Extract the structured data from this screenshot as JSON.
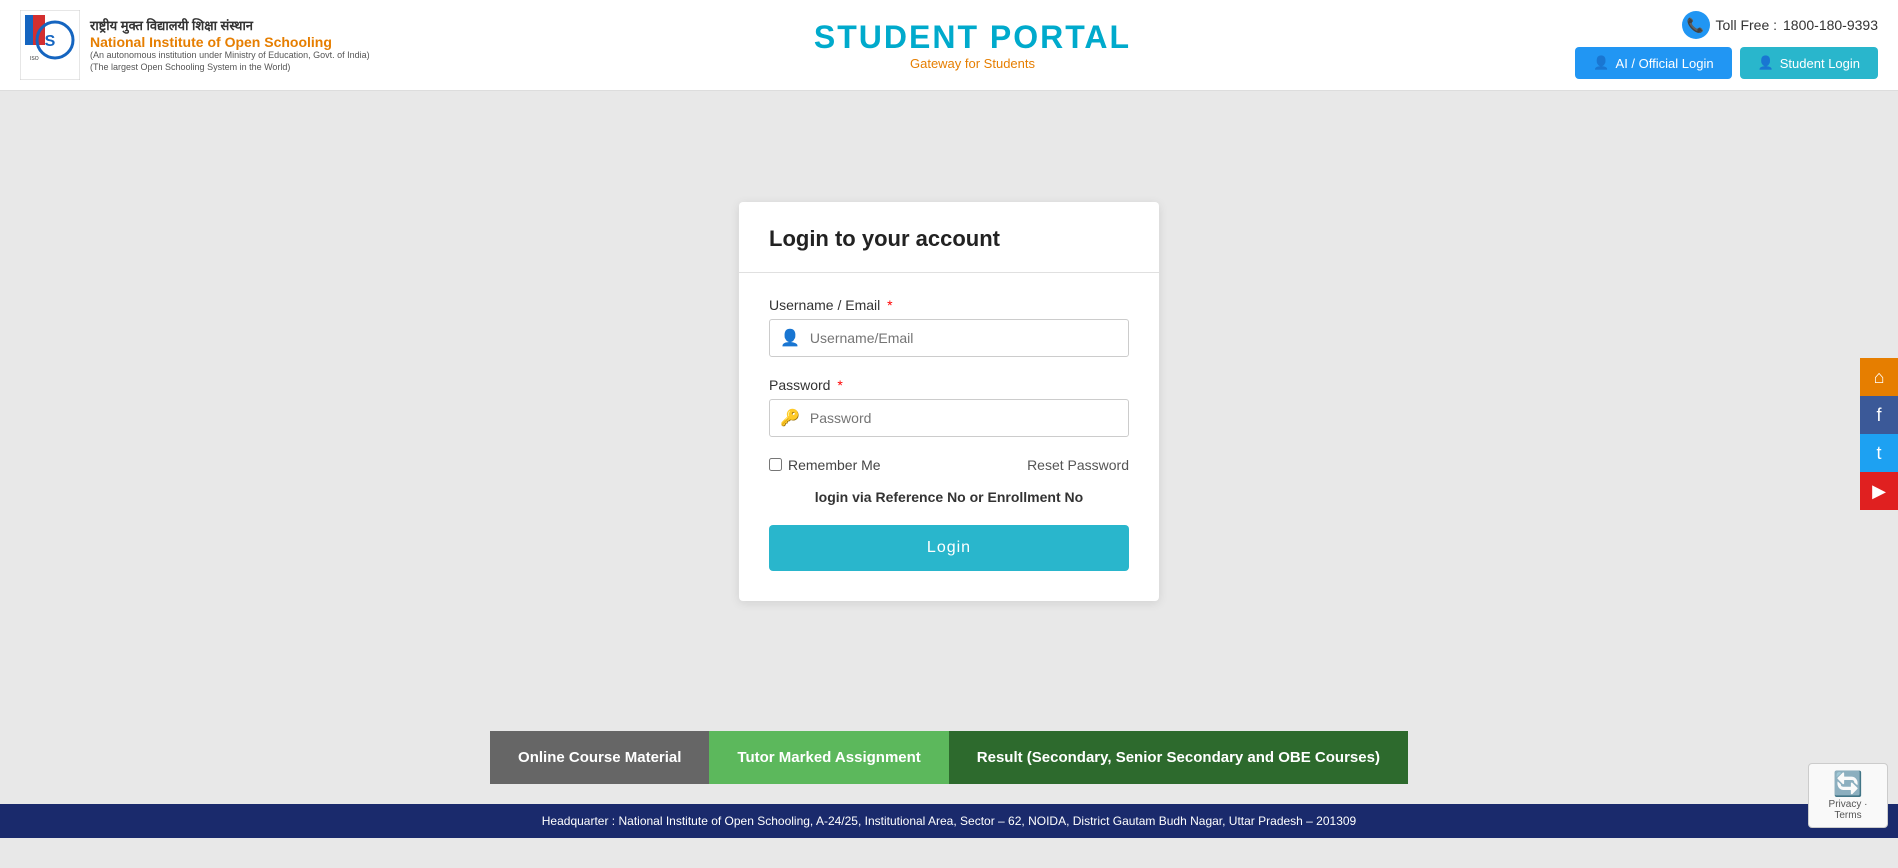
{
  "header": {
    "logo_hindi": "राष्ट्रीय मुक्त विद्यालयी शिक्षा संस्थान",
    "logo_name_prefix": "National Institute of ",
    "logo_name_bold": "Open Schooling",
    "logo_sub1": "(An autonomous institution under Ministry of Education, Govt. of India)",
    "logo_sub2": "(The largest Open Schooling System in the World)",
    "portal_title": "STUDENT PORTAL",
    "portal_subtitle": "Gateway for Students",
    "toll_free_label": "Toll Free :",
    "toll_free_number": "1800-180-9393",
    "btn_ai_login": "AI / Official Login",
    "btn_student_login": "Student Login"
  },
  "login_form": {
    "title": "Login to your account",
    "username_label": "Username / Email",
    "username_placeholder": "Username/Email",
    "password_label": "Password",
    "password_placeholder": "Password",
    "remember_me_label": "Remember Me",
    "reset_password_label": "Reset Password",
    "ref_text": "login via Reference No or Enrollment No",
    "login_btn": "Login"
  },
  "footer_buttons": {
    "btn1": "Online Course Material",
    "btn2": "Tutor Marked Assignment",
    "btn3": "Result (Secondary, Senior Secondary and OBE Courses)"
  },
  "bottom_bar": {
    "text": "Headquarter : National Institute of Open Schooling, A-24/25, Institutional Area, Sector – 62, NOIDA, District Gautam Budh Nagar, Uttar Pradesh – 201309"
  },
  "social": {
    "home_icon": "⌂",
    "facebook_icon": "f",
    "twitter_icon": "t",
    "youtube_icon": "▶"
  },
  "recaptcha": {
    "label": "Privacy · Terms"
  }
}
